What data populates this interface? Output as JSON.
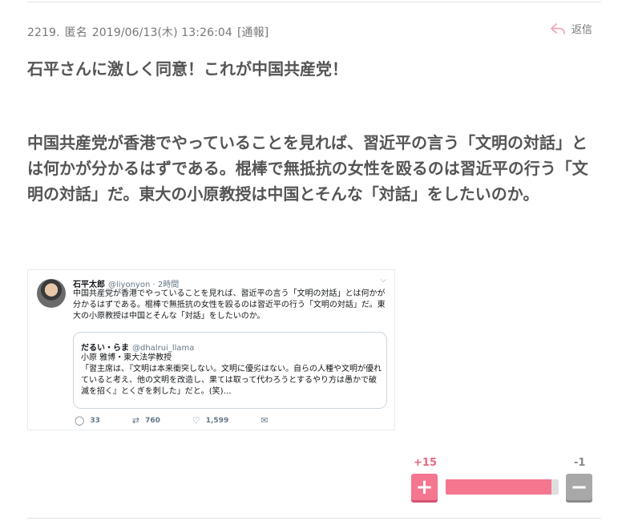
{
  "comment": {
    "meta": {
      "number": "2219.",
      "author": "匿名",
      "datetime": "2019/06/13(木) 13:26:04",
      "report": "[通報]"
    },
    "reply_label": "返信",
    "lines": [
      "石平さんに激しく同意！これが中国共産党！",
      "中国共産党が香港でやっていることを見れば、習近平の言う「文明の対話」とは何かが分かるはずである。棍棒で無抵抗の女性を殴るのは習近平の行う「文明の対話」だ。東大の小原教授は中国とそんな「対話」をしたいのか。"
    ]
  },
  "tweet": {
    "name": "石平太郎",
    "handle": "@liyonyon",
    "time": "· 2時間",
    "text": "中国共産党が香港でやっていることを見れば、習近平の言う「文明の対話」とは何かが分かるはずである。棍棒で無抵抗の女性を殴るのは習近平の行う「文明の対話」だ。東大の小原教授は中国とそんな「対話」をしたいのか。",
    "quote": {
      "name": "だるい・らま",
      "handle": "@dhalrui_llama",
      "line1": "小原 雅博・東大法学教授",
      "text": "「習主席は、『文明は本来衝突しない。文明に優劣はない。自らの人種や文明が優れていると考え、他の文明を改造し、果ては取って代わろうとするやり方は愚かで破滅を招く』とくぎを刺した」だと。(笑)…"
    },
    "replies": "33",
    "retweets": "760",
    "likes": "1,599"
  },
  "votes": {
    "plus": "+15",
    "minus": "-1",
    "plus_ratio": 0.9375,
    "plus_symbol": "+",
    "minus_symbol": "−"
  },
  "colors": {
    "plus": "#f4768f",
    "minus": "#a8a8a8",
    "text": "#555555"
  }
}
